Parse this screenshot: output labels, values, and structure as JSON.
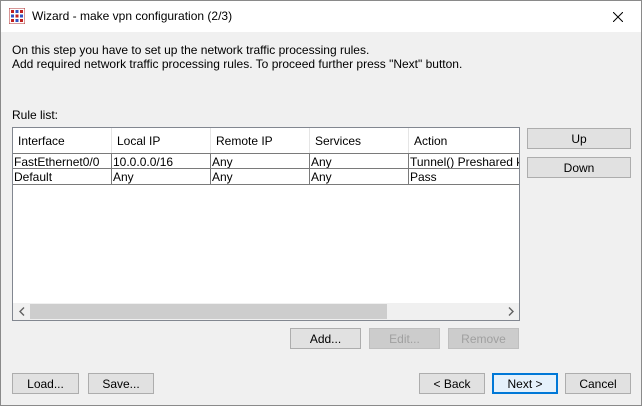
{
  "window": {
    "title": "Wizard - make vpn configuration (2/3)"
  },
  "instructions": {
    "line1": "On this step you have to set up the network traffic processing rules.",
    "line2": "Add required network traffic processing rules. To proceed further press \"Next\" button."
  },
  "rule_list": {
    "label": "Rule list:",
    "columns": [
      "Interface",
      "Local IP",
      "Remote IP",
      "Services",
      "Action"
    ],
    "rows": [
      [
        "FastEthernet0/0",
        "10.0.0.0/16",
        "Any",
        "Any",
        "Tunnel() Preshared key"
      ],
      [
        "Default",
        "Any",
        "Any",
        "Any",
        "Pass"
      ]
    ]
  },
  "side_buttons": {
    "up": "Up",
    "down": "Down"
  },
  "list_buttons": {
    "add": "Add...",
    "edit": "Edit...",
    "remove": "Remove"
  },
  "footer_buttons": {
    "load": "Load...",
    "save": "Save...",
    "back": "< Back",
    "next": "Next >",
    "cancel": "Cancel"
  },
  "icons": {
    "app": "app-icon",
    "close": "close-icon",
    "scroll_left": "chevron-left-icon",
    "scroll_right": "chevron-right-icon"
  },
  "colors": {
    "focus_border": "#0078d7",
    "window_bg": "#f0f0f0"
  }
}
